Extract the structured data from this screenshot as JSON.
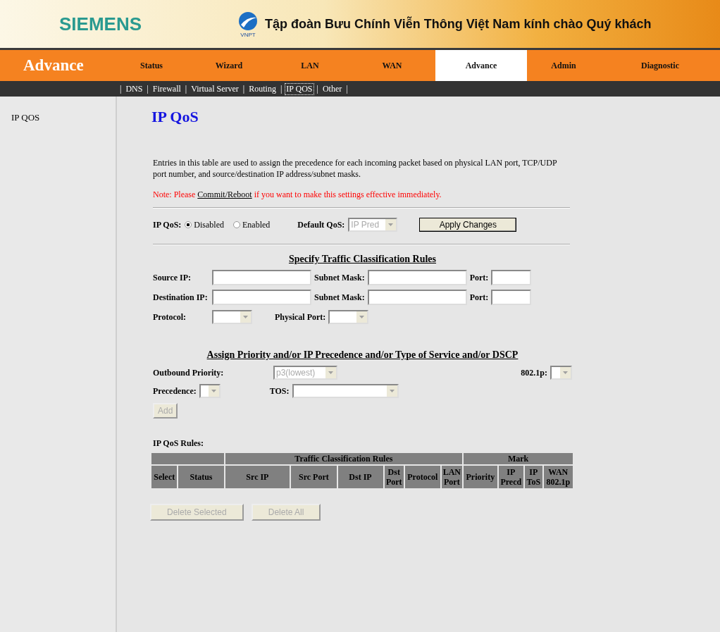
{
  "header": {
    "brand": "SIEMENS",
    "logo_caption": "VNPT",
    "greeting": "Tập đoàn Bưu Chính Viễn Thông Việt Nam kính chào Quý khách"
  },
  "nav": {
    "title": "Advance",
    "tabs": [
      {
        "label": "Status",
        "selected": false
      },
      {
        "label": "Wizard",
        "selected": false
      },
      {
        "label": "LAN",
        "selected": false
      },
      {
        "label": "WAN",
        "selected": false
      },
      {
        "label": "Advance",
        "selected": true
      },
      {
        "label": "Admin",
        "selected": false
      },
      {
        "label": "Diagnostic",
        "selected": false
      }
    ]
  },
  "subnav": {
    "separator": "|",
    "items": [
      {
        "label": "DNS",
        "selected": false
      },
      {
        "label": "Firewall",
        "selected": false
      },
      {
        "label": "Virtual Server",
        "selected": false
      },
      {
        "label": "Routing",
        "selected": false
      },
      {
        "label": "IP QOS",
        "selected": true
      },
      {
        "label": "Other",
        "selected": false
      }
    ]
  },
  "sidebar": {
    "items": [
      {
        "label": "IP QOS"
      }
    ]
  },
  "page": {
    "title": "IP QoS",
    "description": "Entries in this table are used to assign the precedence for each incoming packet based on physical LAN port, TCP/UDP port number, and source/destination IP address/subnet masks.",
    "note": {
      "before": "Note: Please ",
      "link": "Commit/Reboot",
      "after": " if you want to make this settings effective immediately."
    }
  },
  "qos": {
    "label": "IP QoS:",
    "options": [
      {
        "label": "Disabled",
        "selected": true
      },
      {
        "label": "Enabled",
        "selected": false
      }
    ],
    "default_label": "Default QoS:",
    "default_value": "IP Pred",
    "default_disabled": true,
    "apply": "Apply Changes"
  },
  "classification": {
    "heading": "Specify Traffic Classification Rules",
    "rows": [
      [
        {
          "kind": "label",
          "text": "Source IP:"
        },
        {
          "kind": "text"
        },
        {
          "kind": "label",
          "text": "Subnet Mask:"
        },
        {
          "kind": "text"
        },
        {
          "kind": "label",
          "text": "Port:"
        },
        {
          "kind": "text"
        }
      ],
      [
        {
          "kind": "label",
          "text": "Destination IP:"
        },
        {
          "kind": "text"
        },
        {
          "kind": "label",
          "text": "Subnet Mask:"
        },
        {
          "kind": "text"
        },
        {
          "kind": "label",
          "text": "Port:"
        },
        {
          "kind": "text"
        }
      ],
      [
        {
          "kind": "label",
          "text": "Protocol:"
        },
        {
          "kind": "select"
        },
        {
          "kind": "label",
          "text": "Physical Port:"
        },
        {
          "kind": "select"
        }
      ]
    ]
  },
  "assign": {
    "heading": "Assign Priority and/or IP Precedence and/or Type of Service and/or DSCP",
    "outbound_label": "Outbound Priority:",
    "outbound_value": "p3(lowest)",
    "outbound_disabled": true,
    "dot1p_label": "802.1p:",
    "precedence_label": "Precedence:",
    "tos_label": "TOS:",
    "add": {
      "label": "Add",
      "disabled": true
    }
  },
  "rules": {
    "title": "IP QoS Rules:",
    "groups": [
      "Traffic Classification Rules",
      "Mark"
    ],
    "columns": [
      "Select",
      "Status",
      "Src IP",
      "Src Port",
      "Dst IP",
      "Dst Port",
      "Protocol",
      "LAN Port",
      "Priority",
      "IP Precd",
      "IP ToS",
      "WAN 802.1p"
    ],
    "buttons": [
      {
        "label": "Delete Selected",
        "disabled": true
      },
      {
        "label": "Delete All",
        "disabled": true
      }
    ]
  }
}
